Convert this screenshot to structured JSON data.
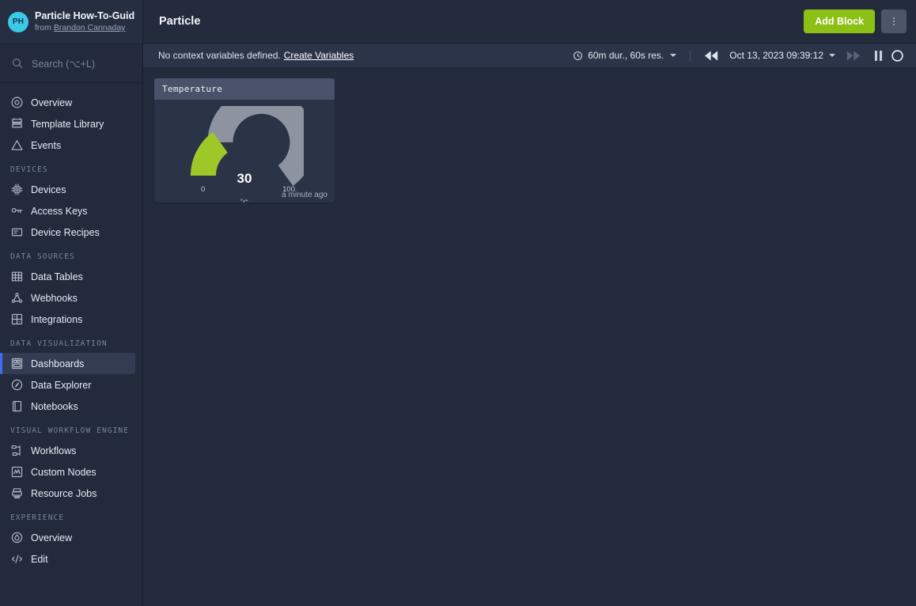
{
  "sidebar": {
    "org": {
      "avatar_initials": "PH",
      "title": "Particle How-To-Guide",
      "from_label": "from",
      "author": "Brandon Cannaday"
    },
    "search": {
      "placeholder": "Search (⌥+L)",
      "icon": "search-icon"
    },
    "groups": [
      {
        "label": "",
        "items": [
          {
            "label": "Overview",
            "icon": "overview-icon",
            "active": false
          },
          {
            "label": "Template Library",
            "icon": "template-library-icon",
            "active": false
          },
          {
            "label": "Events",
            "icon": "events-icon",
            "active": false
          }
        ]
      },
      {
        "label": "DEVICES",
        "items": [
          {
            "label": "Devices",
            "icon": "devices-icon",
            "active": false
          },
          {
            "label": "Access Keys",
            "icon": "access-keys-icon",
            "active": false
          },
          {
            "label": "Device Recipes",
            "icon": "device-recipes-icon",
            "active": false
          }
        ]
      },
      {
        "label": "DATA SOURCES",
        "items": [
          {
            "label": "Data Tables",
            "icon": "data-tables-icon",
            "active": false
          },
          {
            "label": "Webhooks",
            "icon": "webhooks-icon",
            "active": false
          },
          {
            "label": "Integrations",
            "icon": "integrations-icon",
            "active": false
          }
        ]
      },
      {
        "label": "DATA VISUALIZATION",
        "items": [
          {
            "label": "Dashboards",
            "icon": "dashboards-icon",
            "active": true
          },
          {
            "label": "Data Explorer",
            "icon": "data-explorer-icon",
            "active": false
          },
          {
            "label": "Notebooks",
            "icon": "notebooks-icon",
            "active": false
          }
        ]
      },
      {
        "label": "VISUAL WORKFLOW ENGINE",
        "items": [
          {
            "label": "Workflows",
            "icon": "workflows-icon",
            "active": false
          },
          {
            "label": "Custom Nodes",
            "icon": "custom-nodes-icon",
            "active": false
          },
          {
            "label": "Resource Jobs",
            "icon": "resource-jobs-icon",
            "active": false
          }
        ]
      },
      {
        "label": "EXPERIENCE",
        "items": [
          {
            "label": "Overview",
            "icon": "experience-overview-icon",
            "active": false
          },
          {
            "label": "Edit",
            "icon": "edit-icon",
            "active": false
          }
        ]
      }
    ]
  },
  "topbar": {
    "title": "Particle",
    "add_block_label": "Add Block",
    "kebab_icon": "more-vertical-icon"
  },
  "subbar": {
    "context_text": "No context variables defined.",
    "create_variables_label": "Create Variables",
    "duration_label": "60m dur., 60s res.",
    "clock_icon": "clock-icon",
    "rewind_icon": "rewind-icon",
    "datetime": "Oct 13, 2023 09:39:12",
    "forward_icon": "fast-forward-icon",
    "pause_icon": "pause-icon",
    "loading_icon": "loading-spinner-icon"
  },
  "block": {
    "title": "Temperature",
    "footer": "a minute ago"
  },
  "chart_data": {
    "type": "gauge",
    "title": "Temperature",
    "value": 30,
    "min": 0,
    "max": 100,
    "min_label": "0",
    "max_label": "100",
    "unit": "˚C",
    "value_label": "30",
    "arc_start_deg": 180,
    "arc_end_deg": 360,
    "fill_color": "#9ec828",
    "track_color": "#8d93a0",
    "legend": [],
    "grid": false
  },
  "colors": {
    "accent_green": "#8dc015",
    "gauge_green": "#9ec828",
    "gauge_track": "#8d93a0",
    "active_blue": "#3b6ef5",
    "avatar_cyan": "#3bc9e8",
    "bg_main": "#242b3d",
    "bg_sidebar": "#222a3c",
    "bg_card": "#2b3346",
    "bg_card_header": "#49526a",
    "bg_subbar": "#2c344a"
  }
}
